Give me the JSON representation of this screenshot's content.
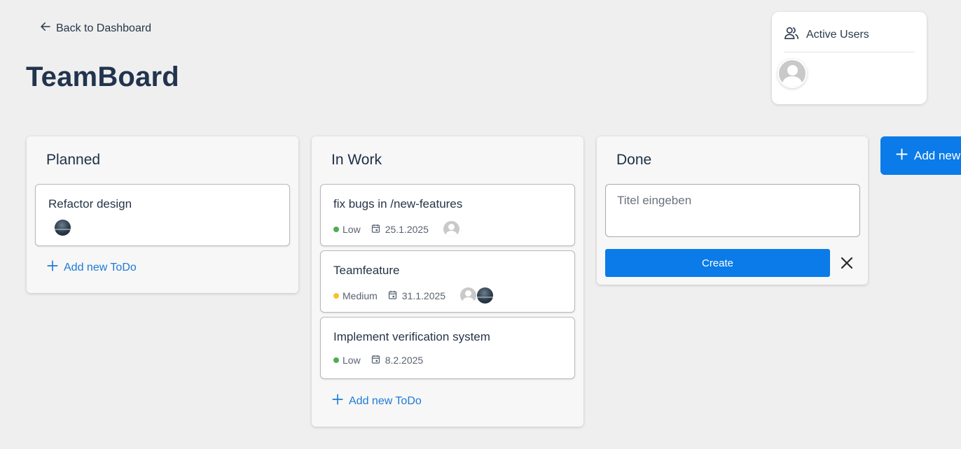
{
  "nav": {
    "back_label": "Back to Dashboard"
  },
  "page": {
    "title": "TeamBoard"
  },
  "active_users": {
    "label": "Active Users"
  },
  "columns": [
    {
      "title": "Planned",
      "cards": [
        {
          "title": "Refactor design",
          "avatars": [
            "photo-avatar"
          ]
        }
      ],
      "add_label": "Add new ToDo"
    },
    {
      "title": "In Work",
      "cards": [
        {
          "title": "fix bugs in /new-features",
          "priority": "Low",
          "priority_color": "#4caf50",
          "date": "25.1.2025",
          "avatars": [
            "default-avatar"
          ]
        },
        {
          "title": "Teamfeature",
          "priority": "Medium",
          "priority_color": "#fbc02d",
          "date": "31.1.2025",
          "avatars": [
            "default-avatar",
            "photo-avatar"
          ]
        },
        {
          "title": "Implement verification system",
          "priority": "Low",
          "priority_color": "#4caf50",
          "date": "8.2.2025",
          "avatars": []
        }
      ],
      "add_label": "Add new ToDo"
    },
    {
      "title": "Done",
      "new_card_form": {
        "placeholder": "Titel eingeben",
        "value": "",
        "create_label": "Create"
      }
    }
  ],
  "add_column": {
    "label": "Add new"
  },
  "colors": {
    "accent": "#0a7be8",
    "link": "#1e7ad6",
    "title": "#22344d",
    "background": "#efefef"
  }
}
